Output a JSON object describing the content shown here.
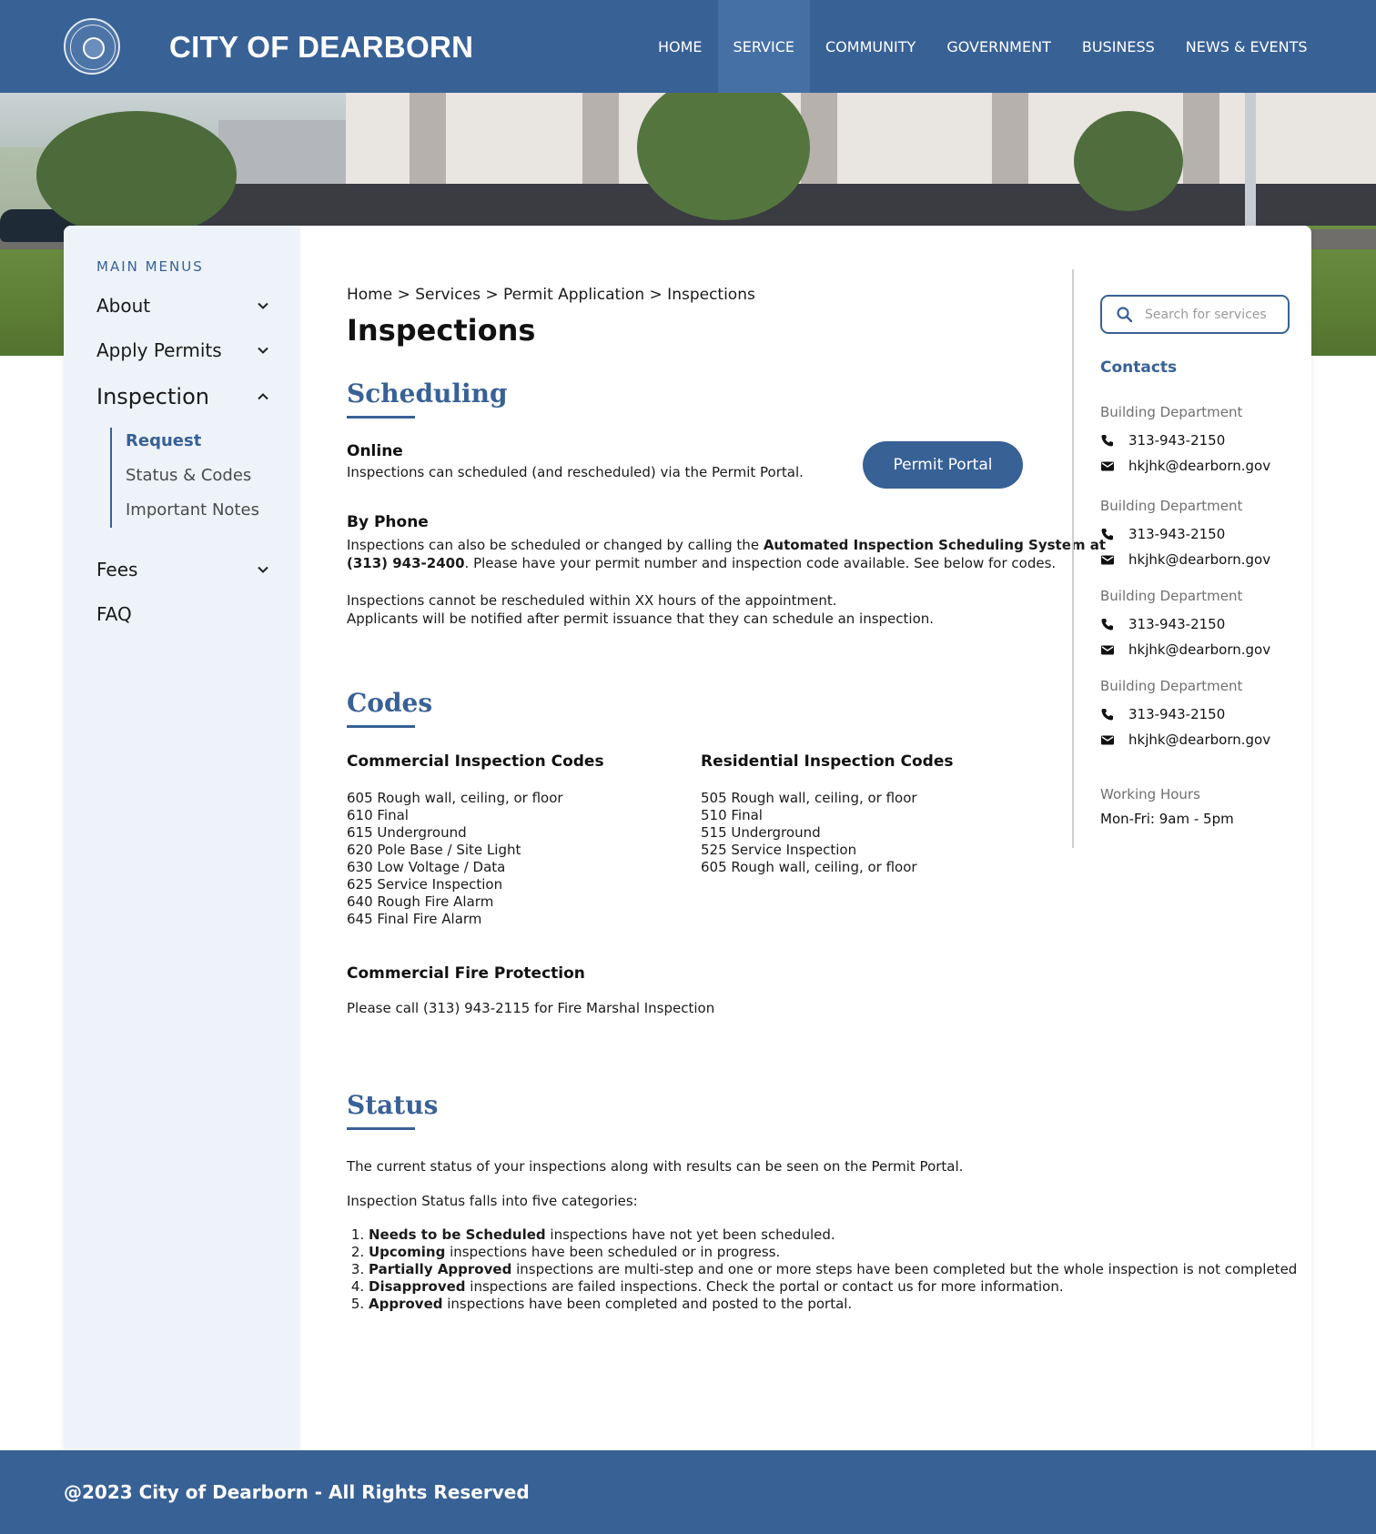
{
  "header": {
    "brand": "CITY OF DEARBORN",
    "nav": [
      "HOME",
      "SERVICE",
      "COMMUNITY",
      "GOVERNMENT",
      "BUSINESS",
      "NEWS & EVENTS"
    ],
    "active_nav": "SERVICE"
  },
  "sidebar": {
    "title": "MAIN MENUS",
    "items": [
      {
        "label": "About"
      },
      {
        "label": "Apply Permits"
      },
      {
        "label": "Inspection"
      },
      {
        "label": "Fees"
      },
      {
        "label": "FAQ"
      }
    ],
    "sub_items": [
      {
        "label": "Request"
      },
      {
        "label": "Status & Codes"
      },
      {
        "label": "Important Notes"
      }
    ]
  },
  "breadcrumb": "Home > Services > Permit Application > Inspections",
  "page_title": "Inspections",
  "scheduling": {
    "title": "Scheduling",
    "online_heading": "Online",
    "online_text": "Inspections can scheduled (and rescheduled) via the Permit Portal.",
    "portal_button": "Permit Portal",
    "phone_heading": "By Phone",
    "phone_text_1a": "Inspections can also be scheduled or changed by calling the ",
    "phone_text_1b": "Automated Inspection Scheduling System at",
    "phone_text_2a": "(313) 943-2400",
    "phone_text_2b": ". Please have your permit number and inspection code available. See below for codes.",
    "note_1": "Inspections cannot be rescheduled within XX hours of the appointment.",
    "note_2": "Applicants will be notified after permit issuance that they can schedule an inspection."
  },
  "codes": {
    "title": "Codes",
    "commercial_heading": "Commercial Inspection Codes",
    "commercial": [
      "605 Rough wall, ceiling, or floor",
      "610 Final",
      "615 Underground",
      "620 Pole Base / Site Light",
      "630 Low Voltage / Data",
      "625 Service Inspection",
      "640 Rough Fire Alarm",
      "645 Final Fire Alarm"
    ],
    "residential_heading": "Residential Inspection Codes",
    "residential": [
      "505 Rough wall, ceiling, or floor",
      "510 Final",
      "515 Underground",
      "525 Service Inspection",
      "605 Rough wall, ceiling, or floor"
    ],
    "fire_heading": "Commercial Fire Protection",
    "fire_text": "Please call (313) 943-2115 for Fire Marshal Inspection"
  },
  "status": {
    "title": "Status",
    "intro": "The current status of your inspections along with results can be seen on the Permit Portal.",
    "categories_intro": "Inspection Status falls into five categories:",
    "items": [
      {
        "term": "Needs to be Scheduled",
        "desc": " inspections have not yet been scheduled."
      },
      {
        "term": "Upcoming",
        "desc": " inspections have been scheduled or in progress."
      },
      {
        "term": "Partially Approved",
        "desc": " inspections are multi-step and one or more steps have been completed but the whole inspection is not completed"
      },
      {
        "term": "Disapproved",
        "desc": " inspections are failed inspections. Check the portal or contact us for more information."
      },
      {
        "term": "Approved",
        "desc": " inspections have been completed and posted to the portal."
      }
    ]
  },
  "right": {
    "search_placeholder": "Search for services",
    "contacts_title": "Contacts",
    "contacts": [
      {
        "dept": "Building Department",
        "phone": "313-943-2150",
        "email": "hkjhk@dearborn.gov"
      },
      {
        "dept": "Building Department",
        "phone": "313-943-2150",
        "email": "hkjhk@dearborn.gov"
      },
      {
        "dept": "Building Department",
        "phone": "313-943-2150",
        "email": "hkjhk@dearborn.gov"
      },
      {
        "dept": "Building Department",
        "phone": "313-943-2150",
        "email": "hkjhk@dearborn.gov"
      }
    ],
    "hours_label": "Working Hours",
    "hours_value": "Mon-Fri: 9am - 5pm"
  },
  "footer": "@2023 City of Dearborn - All Rights Reserved",
  "colors": {
    "primary": "#386196",
    "sidebar_bg": "#eef3fa",
    "nav_active": "#4570a6"
  },
  "icons": {
    "logo": "city-seal",
    "chevrons": "chevron-down-icon",
    "search": "search-icon",
    "phone": "phone-icon",
    "email": "mail-icon"
  }
}
